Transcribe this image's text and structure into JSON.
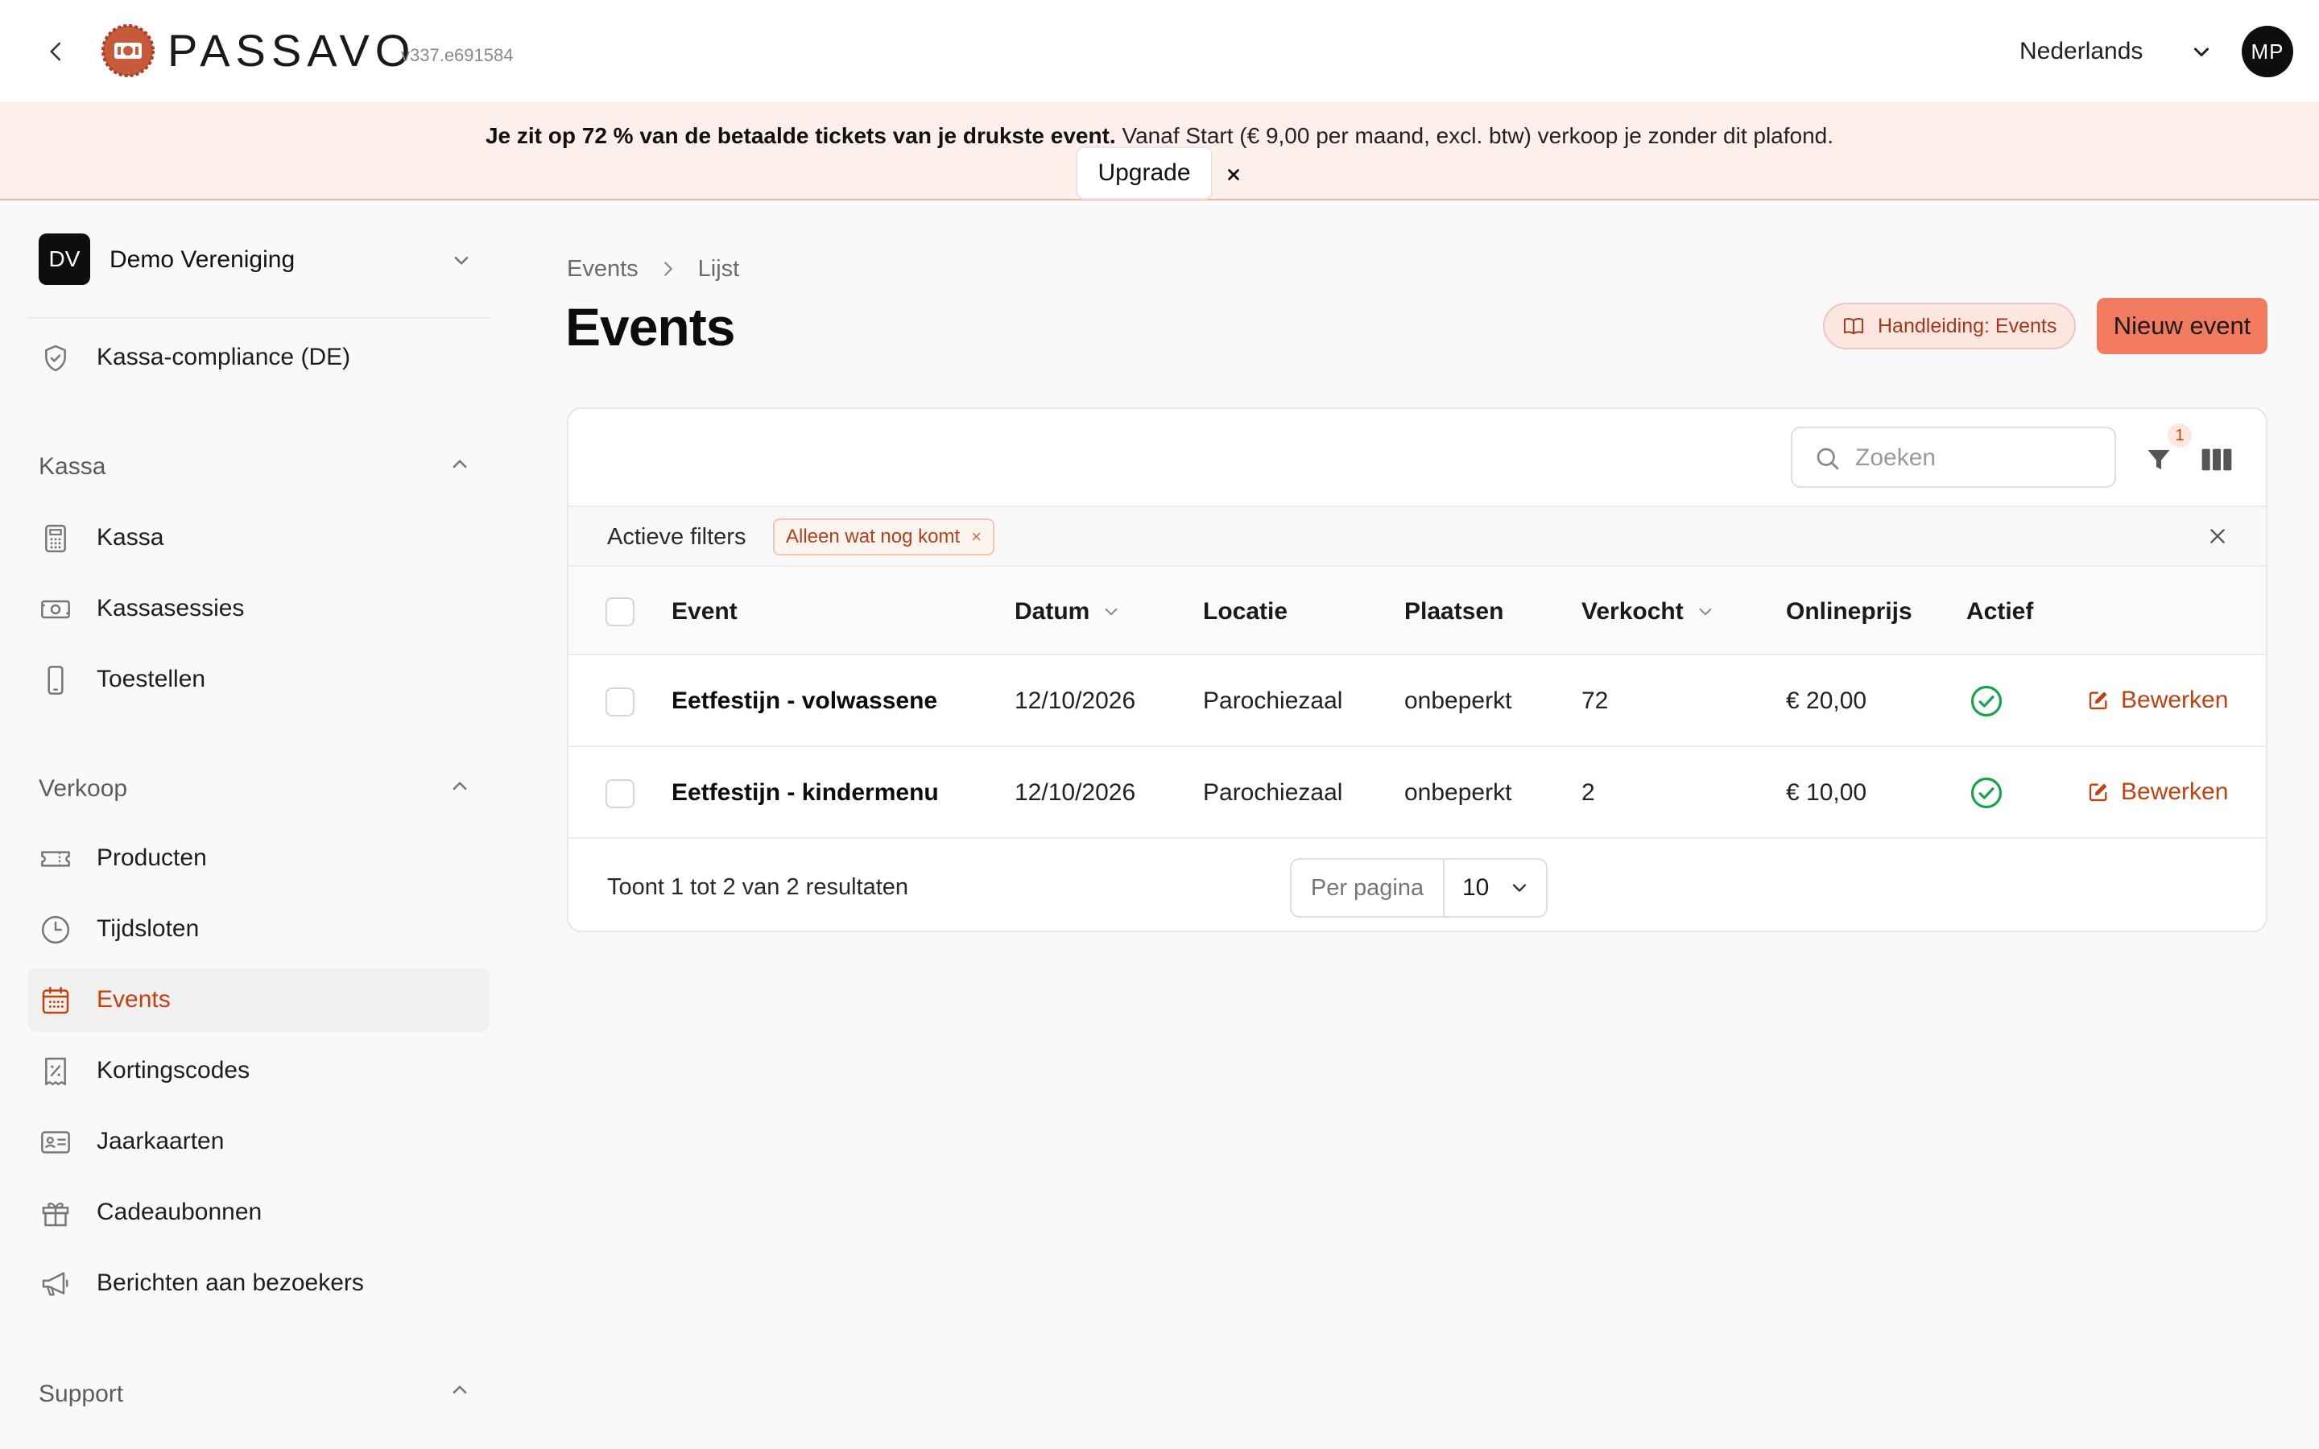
{
  "app": {
    "brand": "PASSAVO",
    "version": "v337.e691584",
    "language": "Nederlands",
    "user_initials": "MP",
    "accent_color": "#f27a5e"
  },
  "banner": {
    "bold_text": "Je zit op 72 % van de betaalde tickets van je drukste event.",
    "text": " Vanaf Start (€ 9,00 per maand, excl. btw) verkoop je zonder dit plafond.",
    "upgrade_label": "Upgrade",
    "close_label": "×"
  },
  "sidebar": {
    "org_initials": "DV",
    "org_name": "Demo Vereniging",
    "top_items": [
      {
        "label": "Kassa-compliance (DE)",
        "icon": "shield-check-icon"
      }
    ],
    "sections": [
      {
        "title": "Kassa",
        "items": [
          {
            "label": "Kassa",
            "icon": "calculator-icon"
          },
          {
            "label": "Kassasessies",
            "icon": "cash-icon"
          },
          {
            "label": "Toestellen",
            "icon": "phone-icon"
          }
        ]
      },
      {
        "title": "Verkoop",
        "items": [
          {
            "label": "Producten",
            "icon": "ticket-icon"
          },
          {
            "label": "Tijdsloten",
            "icon": "clock-icon"
          },
          {
            "label": "Events",
            "icon": "calendar-icon",
            "active": true
          },
          {
            "label": "Kortingscodes",
            "icon": "discount-receipt-icon"
          },
          {
            "label": "Jaarkaarten",
            "icon": "id-card-icon"
          },
          {
            "label": "Cadeaubonnen",
            "icon": "gift-icon"
          },
          {
            "label": "Berichten aan bezoekers",
            "icon": "megaphone-icon"
          }
        ]
      },
      {
        "title": "Support",
        "items": []
      }
    ]
  },
  "main": {
    "breadcrumb": [
      "Events",
      "Lijst"
    ],
    "title": "Events",
    "manual_label": "Handleiding: Events",
    "new_label": "Nieuw event",
    "search_placeholder": "Zoeken",
    "filter_count": "1",
    "active_filters_label": "Actieve filters",
    "active_filter_chip": "Alleen wat nog komt",
    "chip_remove": "×",
    "columns": [
      "Event",
      "Datum",
      "Locatie",
      "Plaatsen",
      "Verkocht",
      "Onlineprijs",
      "Actief"
    ],
    "rows": [
      {
        "event": "Eetfestijn - volwassene",
        "datum": "12/10/2026",
        "locatie": "Parochiezaal",
        "plaatsen": "onbeperkt",
        "verkocht": "72",
        "prijs": "€ 20,00",
        "actief": true,
        "edit_label": "Bewerken"
      },
      {
        "event": "Eetfestijn - kindermenu",
        "datum": "12/10/2026",
        "locatie": "Parochiezaal",
        "plaatsen": "onbeperkt",
        "verkocht": "2",
        "prijs": "€ 10,00",
        "actief": true,
        "edit_label": "Bewerken"
      }
    ],
    "results_text": "Toont 1 tot 2 van 2 resultaten",
    "per_page_label": "Per pagina",
    "per_page_value": "10"
  }
}
